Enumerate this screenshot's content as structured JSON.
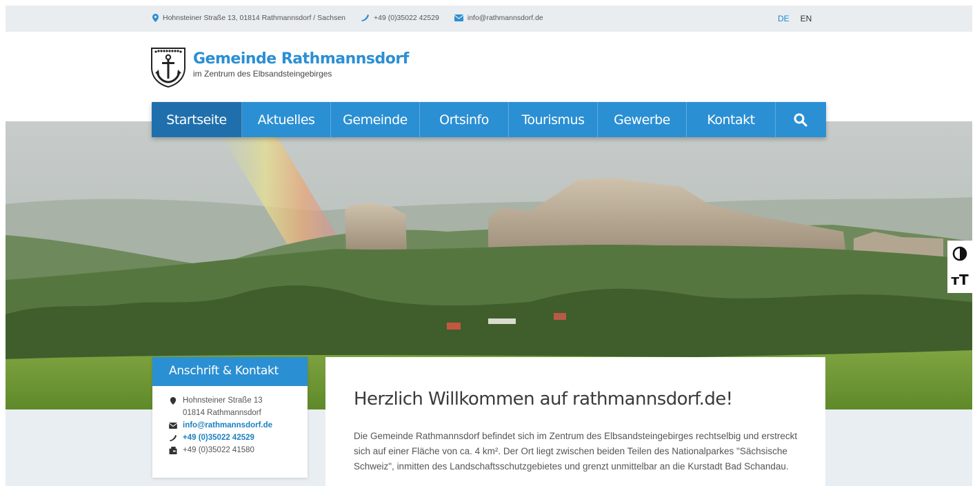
{
  "topbar": {
    "address": "Hohnsteiner Straße 13, 01814 Rathmannsdorf / Sachsen",
    "phone": "+49 (0)35022 42529",
    "email": "info@rathmannsdorf.de",
    "lang_de": "DE",
    "lang_en": "EN"
  },
  "brand": {
    "title": "Gemeinde Rathmannsdorf",
    "subtitle": "im Zentrum des Elbsandsteingebirges"
  },
  "nav": {
    "items": [
      {
        "label": "Startseite",
        "active": true
      },
      {
        "label": "Aktuelles"
      },
      {
        "label": "Gemeinde"
      },
      {
        "label": "Ortsinfo"
      },
      {
        "label": "Tourismus"
      },
      {
        "label": "Gewerbe"
      },
      {
        "label": "Kontakt"
      }
    ],
    "search_icon": "search-icon"
  },
  "side_tools": {
    "contrast_icon": "contrast-icon",
    "font_size_label": "тT"
  },
  "contact_box": {
    "title": "Anschrift & Kontakt",
    "street": "Hohnsteiner Straße 13",
    "city": "01814 Rathmannsdorf",
    "email": "info@rathmannsdorf.de",
    "phone": "+49 (0)35022 42529",
    "fax": "+49 (0)35022 41580"
  },
  "welcome": {
    "title": "Herzlich Willkommen auf rathmannsdorf.de!",
    "text": "Die Gemeinde Rathmannsdorf befindet sich im Zentrum des Elbsandsteingebirges rechtselbig und erstreckt sich auf einer Fläche von ca. 4 km². Der Ort liegt zwischen beiden Teilen des Nationalparkes \"Sächsische Schweiz\", inmitten des Landschaftsschutzgebietes und grenzt unmittelbar an die Kurstadt Bad Schandau."
  },
  "colors": {
    "accent": "#2b8fd3",
    "accent_dark": "#1f6fac",
    "topbar_bg": "#e9edf0"
  }
}
